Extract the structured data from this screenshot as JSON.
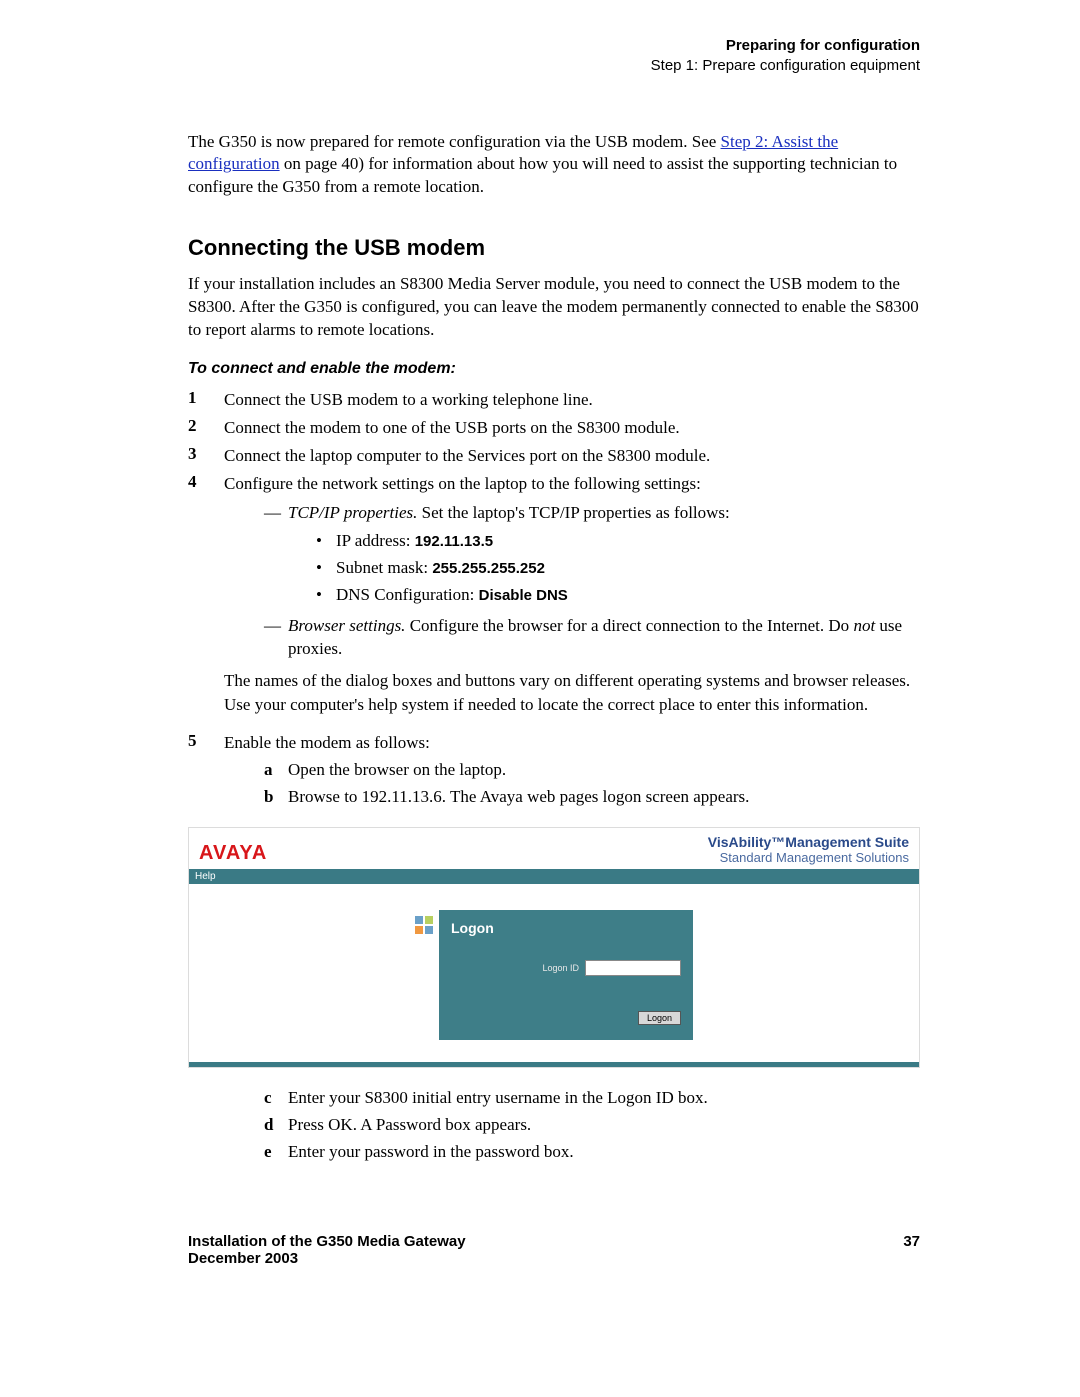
{
  "header": {
    "section": "Preparing for configuration",
    "step": "Step 1: Prepare configuration equipment"
  },
  "intro": {
    "pre": "The G350 is now prepared for remote configuration via the USB modem. See ",
    "link": "Step 2: Assist the configuration",
    "post": " on page 40) for information about how you will need to assist the supporting technician to configure the G350 from a remote location."
  },
  "h2": "Connecting the USB modem",
  "p2": "If your installation includes an S8300 Media Server module, you need to connect the USB modem to the S8300. After the G350 is configured, you can leave the modem permanently connected to enable the S8300 to report alarms to remote locations.",
  "sub": "To connect and enable the modem:",
  "steps": {
    "s1": "Connect the USB modem to a working telephone line.",
    "s2": "Connect the modem to one of the USB ports on the S8300 module.",
    "s3": "Connect the laptop computer to the Services port on the S8300 module.",
    "s4": "Configure the network settings on the laptop to the following settings:",
    "s5": "Enable the modem as follows:"
  },
  "tcpip": {
    "lead_i": "TCP/IP properties.",
    "lead_r": " Set the laptop's TCP/IP properties as follows:",
    "ip_l": "IP address: ",
    "ip_v": "192.11.13.5",
    "sn_l": "Subnet mask: ",
    "sn_v": "255.255.255.252",
    "dns_l": "DNS Configuration: ",
    "dns_v": "Disable DNS"
  },
  "browser": {
    "lead_i": "Browser settings.",
    "lead_r1": " Configure the browser for a direct connection to the Internet. Do ",
    "not": "not",
    "lead_r2": " use proxies."
  },
  "note4": "The names of the dialog boxes and buttons vary on different operating systems and browser releases. Use your computer's help system if needed to locate the correct place to enter this information.",
  "sub5a": "Open the browser on the laptop.",
  "sub5b": "Browse to 192.11.13.6. The Avaya web pages logon screen appears.",
  "sub5c": "Enter your S8300 initial entry username in the Logon ID box.",
  "sub5d": "Press OK. A Password box appears.",
  "sub5e": "Enter your password in the password box.",
  "shot": {
    "brand": "AVAYA",
    "suite1": "VisAbility™Management Suite",
    "suite2": "Standard Management Solutions",
    "help": "Help",
    "logon": "Logon",
    "idlabel": "Logon ID",
    "button": "Logon"
  },
  "footer": {
    "t1": "Installation of the G350 Media Gateway",
    "t2": "December 2003",
    "page": "37"
  }
}
